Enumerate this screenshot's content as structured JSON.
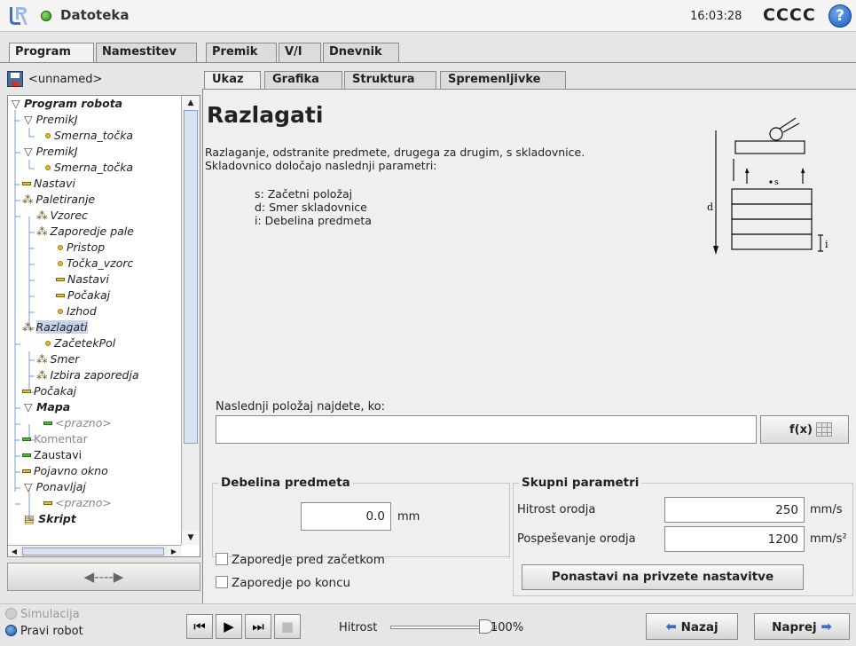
{
  "header": {
    "title": "Datoteka",
    "clock": "16:03:28",
    "robot_name": "CCCC",
    "help_label": "?"
  },
  "main_tabs": [
    {
      "label": "Program",
      "active": true
    },
    {
      "label": "Namestitev",
      "active": false
    },
    {
      "label": "Premik",
      "active": false
    },
    {
      "label": "V/I",
      "active": false
    },
    {
      "label": "Dnevnik",
      "active": false
    }
  ],
  "file": {
    "name": "<unnamed>"
  },
  "tree": [
    {
      "label": "Program robota",
      "icon": "triangle-icon",
      "style": "bold"
    },
    {
      "label": "PremikJ",
      "icon": "triangle-icon"
    },
    {
      "label": "Smerna_točka",
      "icon": "waypoint-icon"
    },
    {
      "label": "PremikJ",
      "icon": "triangle-icon"
    },
    {
      "label": "Smerna_točka",
      "icon": "waypoint-icon"
    },
    {
      "label": "Nastavi",
      "icon": "bar-icon"
    },
    {
      "label": "Paletiranje",
      "icon": "pallet-icon"
    },
    {
      "label": "Vzorec",
      "icon": "pallet-icon"
    },
    {
      "label": "Zaporedje pale",
      "icon": "pallet-icon"
    },
    {
      "label": "Pristop",
      "icon": "waypoint-icon"
    },
    {
      "label": "Točka_vzorc",
      "icon": "waypoint-icon"
    },
    {
      "label": "Nastavi",
      "icon": "bar-icon"
    },
    {
      "label": "Počakaj",
      "icon": "bar-icon"
    },
    {
      "label": "Izhod",
      "icon": "waypoint-icon"
    },
    {
      "label": "Razlagati",
      "icon": "pallet-icon",
      "selected": true
    },
    {
      "label": "ZačetekPol",
      "icon": "waypoint-icon"
    },
    {
      "label": "Smer",
      "icon": "pallet-icon"
    },
    {
      "label": "Izbira zaporedja",
      "icon": "pallet-icon"
    },
    {
      "label": "Počakaj",
      "icon": "bar-icon"
    },
    {
      "label": "Mapa",
      "icon": "triangle-icon",
      "style": "bold"
    },
    {
      "label": "<prazno>",
      "icon": "bar-icon",
      "style": "gray"
    },
    {
      "label": "Komentar",
      "icon": "bar-icon",
      "style": "gray"
    },
    {
      "label": "Zaustavi",
      "icon": "bar-icon"
    },
    {
      "label": "Pojavno okno",
      "icon": "bar-icon"
    },
    {
      "label": "Ponavljaj",
      "icon": "triangle-icon"
    },
    {
      "label": "<prazno>",
      "icon": "bar-icon",
      "style": "gray"
    },
    {
      "label": "Skript",
      "icon": "script-icon",
      "style": "bold"
    }
  ],
  "move_button_label": "◀----▶",
  "sub_tabs": [
    {
      "label": "Ukaz",
      "active": true
    },
    {
      "label": "Grafika",
      "active": false
    },
    {
      "label": "Struktura",
      "active": false
    },
    {
      "label": "Spremenljivke",
      "active": false
    }
  ],
  "content": {
    "title": "Razlagati",
    "desc_line1": "Razlaganje, odstranite predmete, drugega za drugim, s skladovnice.",
    "desc_line2": "Skladovnico določajo naslednji parametri:",
    "param_s": "s: Začetni položaj",
    "param_d": "d: Smer skladovnice",
    "param_i": "i: Debelina predmeta",
    "diagram_d": "d",
    "diagram_s": "s",
    "diagram_i": "i",
    "next_label": "Naslednji položaj najdete, ko:",
    "next_value": "",
    "fx_label": "f(x)",
    "thickness": {
      "title": "Debelina predmeta",
      "value": "0.0",
      "unit": "mm"
    },
    "shared": {
      "title": "Skupni parametri",
      "speed_label": "Hitrost orodja",
      "speed_value": "250",
      "speed_unit": "mm/s",
      "accel_label": "Pospeševanje orodja",
      "accel_value": "1200",
      "accel_unit": "mm/s²",
      "reset_label": "Ponastavi na privzete nastavitve"
    },
    "check_before": "Zaporedje pred začetkom",
    "check_after": "Zaporedje po koncu"
  },
  "footer": {
    "mode_sim": "Simulacija",
    "mode_real": "Pravi robot",
    "speed_label": "Hitrost",
    "speed_value": "100%",
    "speed_level": 1.0,
    "back_label": "Nazaj",
    "next_label": "Naprej"
  },
  "colors": {
    "accent": "#3f6fc4",
    "status_ok": "#2c8a0c",
    "selection": "#c7d3ea"
  }
}
